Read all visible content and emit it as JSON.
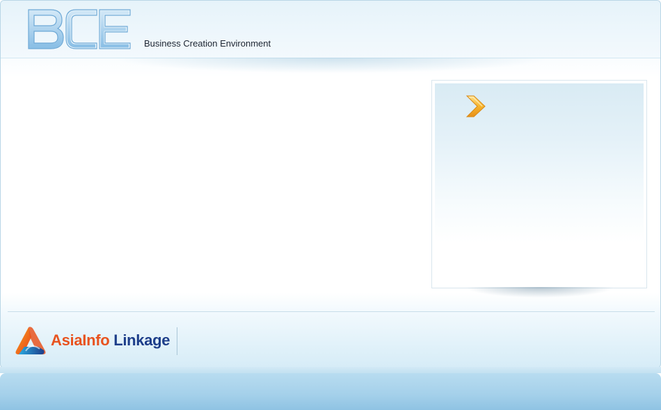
{
  "header": {
    "logo_text": "BCE",
    "subtitle": "Business Creation Environment"
  },
  "side_panel": {
    "icon": "chevron-right-icon"
  },
  "footer": {
    "brand_part_a": "AsiaInfo",
    "brand_part_b": "Linkage",
    "brand_icon": "asiainfo-logo-icon"
  },
  "colors": {
    "accent_orange": "#e8531f",
    "accent_navy": "#1d3e8a",
    "frame_border": "#b9d6e6",
    "bottom_bar": "#a4d0ea"
  }
}
